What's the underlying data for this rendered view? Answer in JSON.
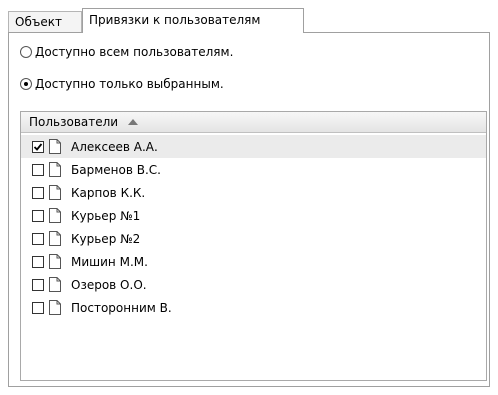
{
  "tabs": [
    {
      "label": "Объект"
    },
    {
      "label": "Привязки к пользователям"
    }
  ],
  "access": {
    "option_all": "Доступно всем пользователям.",
    "option_selected": "Доступно только выбранным.",
    "selected_option": "option_selected"
  },
  "users_list": {
    "header": "Пользователи",
    "sort": "ascending",
    "sort_icon": "sort-ascending-icon",
    "row_icon": "document-icon",
    "items": [
      {
        "name": "Алексеев А.А.",
        "checked": true,
        "selected": true
      },
      {
        "name": "Барменов В.С.",
        "checked": false,
        "selected": false
      },
      {
        "name": "Карпов К.К.",
        "checked": false,
        "selected": false
      },
      {
        "name": "Курьер №1",
        "checked": false,
        "selected": false
      },
      {
        "name": "Курьер №2",
        "checked": false,
        "selected": false
      },
      {
        "name": "Мишин М.М.",
        "checked": false,
        "selected": false
      },
      {
        "name": "Озеров О.О.",
        "checked": false,
        "selected": false
      },
      {
        "name": "Посторонним В.",
        "checked": false,
        "selected": false
      }
    ]
  }
}
